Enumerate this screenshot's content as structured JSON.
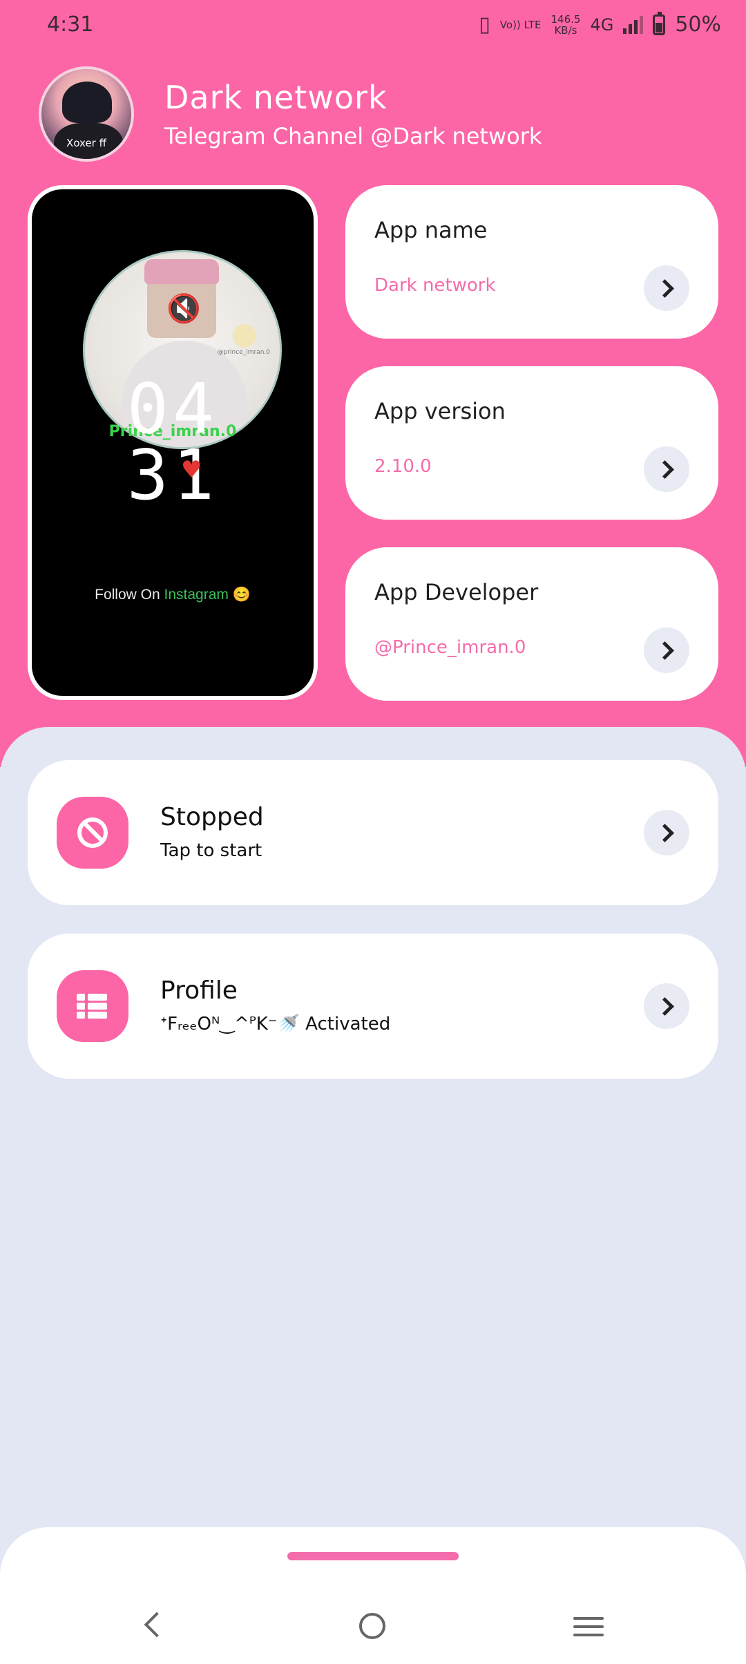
{
  "status_bar": {
    "time": "4:31",
    "network_speed": "146.5",
    "speed_unit": "KB/s",
    "volte": "Vo)) LTE",
    "network_type": "4G",
    "battery": "50%"
  },
  "header": {
    "avatar_label": "Xoxer ff",
    "title": "Dark network",
    "subtitle": "Telegram Channel @Dark network"
  },
  "preview": {
    "name": "Prince_imran.0",
    "clock_hours": "04",
    "clock_minutes": "31",
    "watermark": "@prince_imran.0",
    "follow_prefix": "Follow On ",
    "follow_link": "Instagram",
    "follow_emoji": "😊"
  },
  "info_cards": [
    {
      "label": "App name",
      "value": "Dark network"
    },
    {
      "label": "App version",
      "value": "2.10.0"
    },
    {
      "label": "App Developer",
      "value": "@Prince_imran.0"
    }
  ],
  "list_cards": [
    {
      "title": "Stopped",
      "subtitle": "Tap to start",
      "icon": "ban-icon"
    },
    {
      "title": "Profile",
      "subtitle": "ᐩFᵣₑₑOᴺ‿^ᴾK⁻🚿 Activated",
      "icon": "list-icon"
    }
  ],
  "colors": {
    "accent": "#fd66a6",
    "background": "#e3e6f3",
    "value_text": "#f46cab"
  }
}
